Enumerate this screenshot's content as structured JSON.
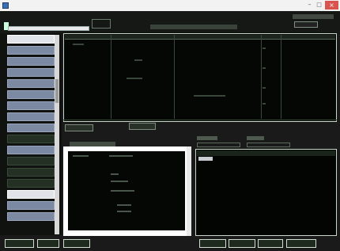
{
  "window": {
    "title": "",
    "controls": {
      "minimize": "–",
      "maximize": "□",
      "close": "×"
    }
  },
  "icons": {
    "app": "app-icon"
  },
  "colors": {
    "panel_bg": "#040704",
    "sidebar_item": "#7b89a3",
    "close_button": "#d9534f"
  },
  "sidebar": {
    "item_count": 17,
    "selected_index": 14
  }
}
